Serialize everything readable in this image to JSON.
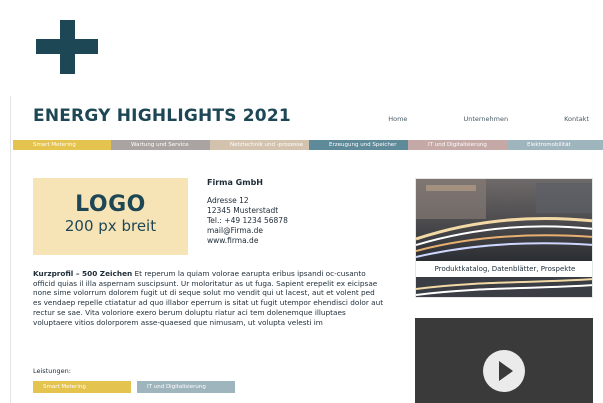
{
  "header": {
    "title": "ENERGY HIGHLIGHTS 2021",
    "nav": [
      "Home",
      "Unternehmen",
      "Kontakt"
    ]
  },
  "categories": [
    "Smart Metering",
    "Wartung und Service",
    "Netztechnik und -prozesse",
    "Erzeugung und Speicher",
    "IT und Digitalisierung",
    "Elektromobilität"
  ],
  "logo": {
    "main": "LOGO",
    "size": "200 px breit"
  },
  "contact": {
    "company": "Firma GmbH",
    "street": "Adresse 12",
    "city": "12345 Musterstadt",
    "phone": "Tel.: +49 1234 56878",
    "email": "mail@Firma.de",
    "web": "www.firma.de"
  },
  "profile": {
    "heading": "Kurzprofil – 500 Zeichen",
    "text": " Et reperum la quiam volorae earupta eribus ipsandi oc-cusanto officid quias il illa aspernam suscipsunt. Ur moloritatur as ut fuga. Sapient erepelit ex eicipsae none sime volorrum dolorem fugit ut di seque solut mo vendit qui ut lacest, aut et volent ped es vendaep repelle ctiatatur ad quo illabor eperrum is sitat ut fugit utempor ehendisci dolor aut rectur se sae. Vita voloriore exero berum doluptu riatur aci tem dolenemque illuptaes voluptaere vitios dolorporem asse-quaesed que nimusam, ut volupta velesti im"
  },
  "leistungen": {
    "label": "Leistungen:",
    "tags": [
      "Smart Metering",
      "IT und Digitalisierung"
    ]
  },
  "right_card": {
    "caption": "Produktkatalog, Datenblätter, Prospekte"
  },
  "icons": {
    "plus": "plus-icon",
    "play": "play-icon"
  },
  "colors": {
    "brand": "#1e4756",
    "yellow": "#e5c34f",
    "teal": "#5f8a99"
  }
}
